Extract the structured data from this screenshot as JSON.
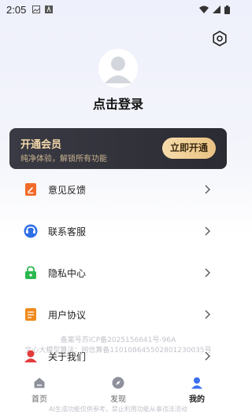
{
  "status_bar": {
    "time": "2:05"
  },
  "header": {
    "settings_icon": "settings-hexagon-icon"
  },
  "profile": {
    "login_prompt": "点击登录",
    "avatar_icon": "default-avatar-icon"
  },
  "vip": {
    "title": "开通会员",
    "subtitle": "纯净体验，解锁所有功能",
    "button_label": "立即开通",
    "colors": {
      "card": "#2f2f38",
      "gold": "#f3d9a9",
      "button": "#eccb8e"
    }
  },
  "menu": {
    "items": [
      {
        "label": "意见反馈",
        "icon": "feedback-icon",
        "color": "#f26b2a"
      },
      {
        "label": "联系客服",
        "icon": "customer-service-icon",
        "color": "#2f6fe6"
      },
      {
        "label": "隐私中心",
        "icon": "privacy-lock-icon",
        "color": "#2cb84e"
      },
      {
        "label": "用户协议",
        "icon": "agreement-document-icon",
        "color": "#f08a1c"
      },
      {
        "label": "关于我们",
        "icon": "about-us-icon",
        "color": "#e33b3b"
      }
    ]
  },
  "filing": {
    "icp": "备案号苏ICP备2025156641号-96A",
    "algorithm": "文心大模型算法：网信算备110108645502801230035号"
  },
  "tabbar": {
    "tabs": [
      {
        "label": "首页",
        "icon": "home-icon",
        "active": false
      },
      {
        "label": "发现",
        "icon": "compass-icon",
        "active": false
      },
      {
        "label": "我的",
        "icon": "profile-icon",
        "active": true
      }
    ],
    "active_color": "#3a6ff0"
  },
  "footer": {
    "disclaimer": "AI生成功能仅供参考，禁止利用功能从事违法活动"
  }
}
